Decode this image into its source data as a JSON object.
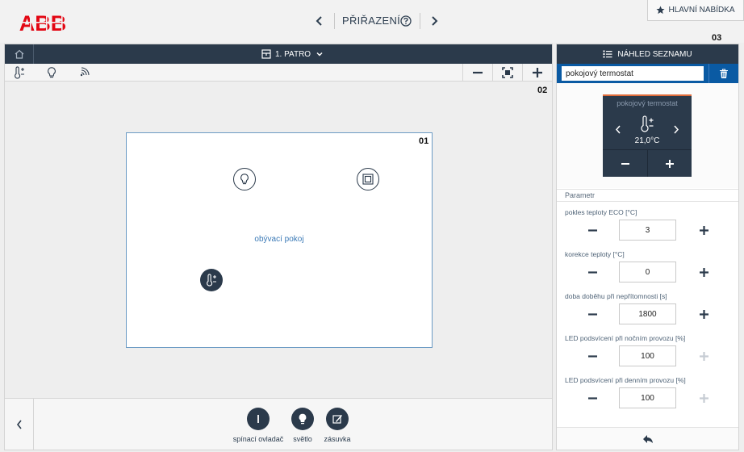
{
  "header": {
    "logo_text": "ABB",
    "title": "PŘIŘAZENÍ",
    "main_menu_label": "HLAVNÍ NABÍDKA"
  },
  "floorplan": {
    "floor_label": "1. PATRO",
    "marker_panel": "02",
    "marker_room": "01",
    "room_name": "obývací pokoj"
  },
  "tray": {
    "items": [
      {
        "label": "spínací ovladač",
        "icon": "switch-actuator-icon"
      },
      {
        "label": "světlo",
        "icon": "light-bulb-icon"
      },
      {
        "label": "zásuvka",
        "icon": "socket-icon"
      }
    ]
  },
  "right_panel": {
    "marker": "03",
    "header_label": "NÁHLED SEZNAMU",
    "device_name_value": "pokojový termostat",
    "preview": {
      "title": "pokojový termostat",
      "temperature": "21,0°C"
    },
    "param_heading": "Parametr",
    "params": [
      {
        "label": "pokles teploty ECO [°C]",
        "value": "3",
        "plus_enabled": true
      },
      {
        "label": "korekce teploty [°C]",
        "value": "0",
        "plus_enabled": true
      },
      {
        "label": "doba doběhu při nepřítomnosti [s]",
        "value": "1800",
        "plus_enabled": true
      },
      {
        "label": "LED podsvícení při nočním provozu [%]",
        "value": "100",
        "plus_enabled": false
      },
      {
        "label": "LED podsvícení při denním provozu [%]",
        "value": "100",
        "plus_enabled": false
      }
    ]
  },
  "colors": {
    "brand_red": "#e30613",
    "navy": "#2b3a4b",
    "accent_blue": "#0a5aa3",
    "disabled": "#c6ccd3"
  }
}
